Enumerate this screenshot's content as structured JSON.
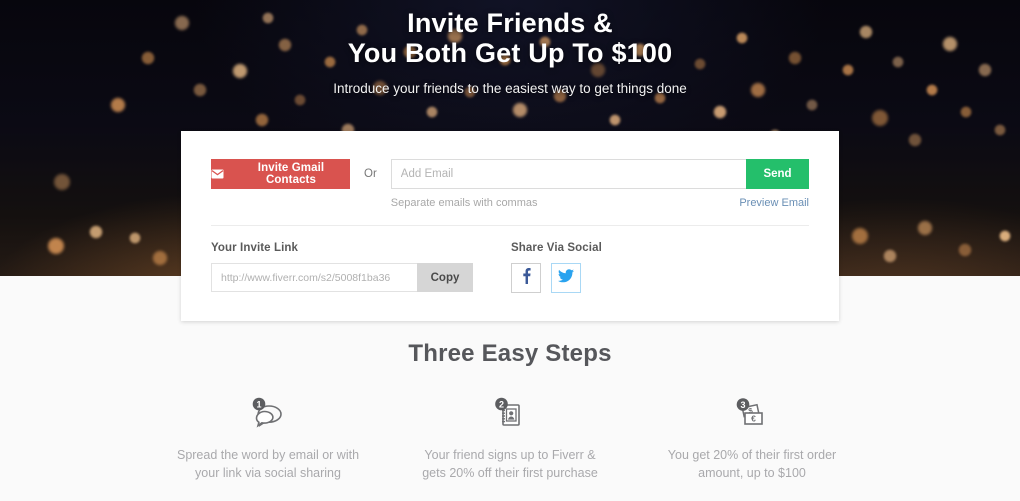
{
  "hero": {
    "title_line1": "Invite Friends &",
    "title_line2": "You Both Get Up To $100",
    "subtitle": "Introduce your friends to the easiest way to get things done"
  },
  "invite_card": {
    "gmail_button_label": "Invite Gmail Contacts",
    "gmail_button_icon": "envelope-icon",
    "or_label": "Or",
    "email_placeholder": "Add Email",
    "email_value": "",
    "send_button_label": "Send",
    "hint_text": "Separate emails with commas",
    "preview_link_label": "Preview Email",
    "invite_link_label": "Your Invite Link",
    "invite_link_value": "http://www.fiverr.com/s2/5008f1ba36",
    "copy_button_label": "Copy",
    "social_label": "Share Via Social",
    "social_buttons": [
      {
        "name": "facebook-icon",
        "glyph": "f"
      },
      {
        "name": "twitter-icon",
        "glyph": "bird"
      }
    ]
  },
  "steps_section": {
    "title": "Three Easy Steps",
    "steps": [
      {
        "number": "1",
        "icon": "speech-bubbles-icon",
        "text_line1": "Spread the word by email or with",
        "text_line2": "your link via social sharing"
      },
      {
        "number": "2",
        "icon": "contact-card-icon",
        "text_line1": "Your friend signs up to Fiverr &",
        "text_line2": "gets 20% off their first purchase"
      },
      {
        "number": "3",
        "icon": "banknotes-icon",
        "text_line1": "You get 20% of their first order",
        "text_line2": "amount, up to $100"
      }
    ]
  },
  "colors": {
    "gmail_red": "#d9534f",
    "send_green": "#24bf6b",
    "hero_dark": "#0a0912",
    "page_background": "#fafafa",
    "twitter_blue": "#2aa3ef",
    "facebook_blue": "#3b5998",
    "link_blue": "#6a8fb5"
  }
}
